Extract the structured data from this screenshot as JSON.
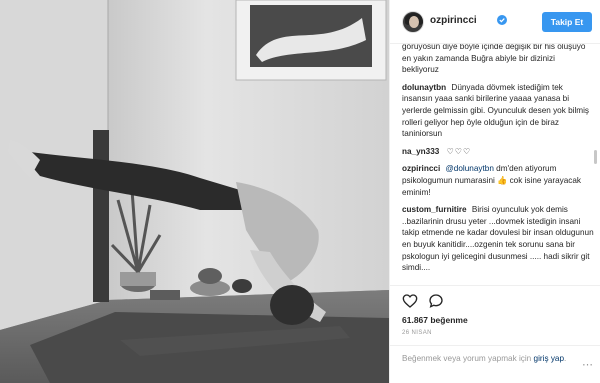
{
  "header": {
    "username": "ozpirincci",
    "follow_label": "Takip Et"
  },
  "comments": [
    {
      "user": "",
      "text": "görüyosun diye böyle içinde değişik bir his oluşuyo en yakın zamanda Buğra abiyle bir dizinizi bekliyoruz"
    },
    {
      "user": "dolunaytbn",
      "text": "Dünyada dövmek istediğim tek insansın yaaa sanki birilerine yaaaa yanasa bi yerlerde gelmissin gibi. Oyunculuk desen yok bilmiş rolleri geliyor hep öyle olduğun için de biraz taniniorsun"
    },
    {
      "user": "na_yn333",
      "text": "♡♡♡"
    },
    {
      "user": "ozpirincci",
      "mention": "@dolunaytbn",
      "text": "dm'den atiyorum psikologumun numarasini 👍 cok isine yarayacak eminim!"
    },
    {
      "user": "custom_furnitire",
      "text": "Birisi oyunculuk yok demis ..bazilarinin drusu yeter ...dovmek istedigin insani takip etmende ne kadar dovulesi bir insan oldugunun en buyuk kanitidir....ozgenin tek sorunu sana bir pskologun iyi gelicegini dusunmesi ..... hadi sikrir git simdi...."
    }
  ],
  "likes": "61.867 beğenme",
  "date": "26 nisan",
  "add_comment": {
    "text": "Beğenmek veya yorum yapmak için",
    "login_label": "giriş yap",
    "trailing": "."
  },
  "icons": {
    "verified": "verified-badge-icon",
    "like": "heart-icon",
    "comment": "comment-bubble-icon",
    "more": "more-options-icon"
  },
  "colors": {
    "accent": "#3897f0",
    "link": "#003569",
    "muted": "#999999",
    "text": "#262626"
  }
}
